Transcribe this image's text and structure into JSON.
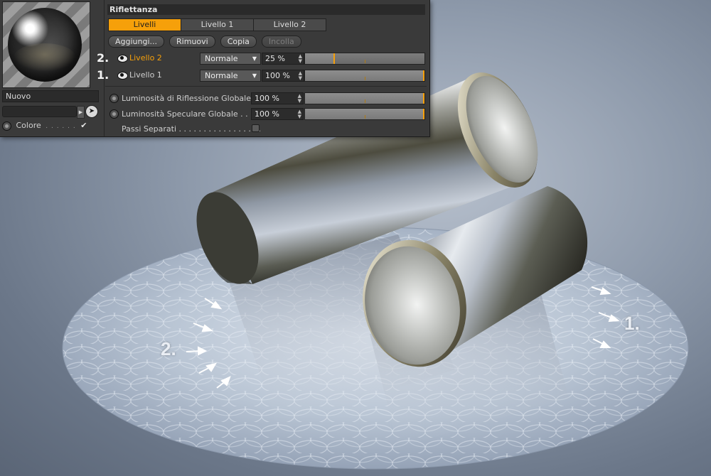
{
  "panel": {
    "left": {
      "name_value": "Nuovo",
      "channel_label": "Colore",
      "channel_dots": ". . . . . .",
      "channel_check": "✔"
    },
    "section_title": "Riflettanza",
    "tabs": [
      {
        "label": "Livelli",
        "active": true
      },
      {
        "label": "Livello 1",
        "active": false
      },
      {
        "label": "Livello 2",
        "active": false
      }
    ],
    "buttons": [
      {
        "label": "Aggiungi...",
        "enabled": true
      },
      {
        "label": "Rimuovi",
        "enabled": true
      },
      {
        "label": "Copia",
        "enabled": true
      },
      {
        "label": "Incolla",
        "enabled": false
      }
    ],
    "layers": [
      {
        "marker": "2.",
        "name": "Livello 2",
        "selected": true,
        "mode": "Normale",
        "amount": "25 %",
        "amount_fraction": 0.25
      },
      {
        "marker": "1.",
        "name": "Livello 1",
        "selected": false,
        "mode": "Normale",
        "amount": "100 %",
        "amount_fraction": 1.0
      }
    ],
    "globals": [
      {
        "label": "Luminosità di Riflessione Globale",
        "value": "100 %",
        "fraction": 1.0
      },
      {
        "label": "Luminosità Speculare Globale . . .",
        "value": "100 %",
        "fraction": 1.0
      }
    ],
    "separate_passes": {
      "label": "Passi Separati . . . . . . . . . . . . . . . . .",
      "checked": false
    }
  },
  "scene": {
    "annotations": [
      {
        "id": "left",
        "text": "2."
      },
      {
        "id": "right",
        "text": "1."
      }
    ]
  },
  "colors": {
    "accent": "#f6a00a",
    "panel_bg": "#3a3a3a",
    "background": "#8e9aab"
  },
  "icons": {
    "visibility": "eye-icon",
    "picker": "cursor-arrow-icon",
    "expand": "triangle-right-icon"
  }
}
